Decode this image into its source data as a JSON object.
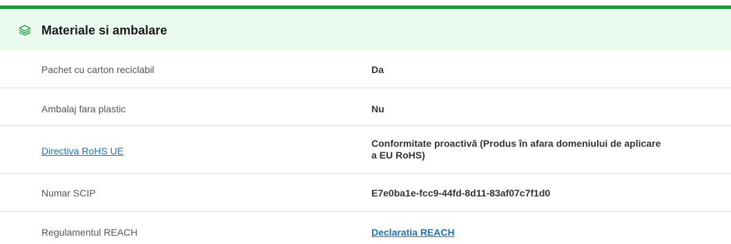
{
  "section": {
    "title": "Materiale si ambalare",
    "icon": "layers-icon",
    "accent_color": "#1e9a3c",
    "header_background": "#eafaee"
  },
  "rows": [
    {
      "label": "Pachet cu carton reciclabil",
      "value": "Da"
    },
    {
      "label": "Ambalaj fara plastic",
      "value": "Nu"
    },
    {
      "label": "Directiva RoHS UE",
      "value": "Conformitate proactivă (Produs în afara domeniului de aplicare a EU RoHS)"
    },
    {
      "label": "Numar SCIP",
      "value": "E7e0ba1e-fcc9-44fd-8d11-83af07c7f1d0"
    },
    {
      "label": "Regulamentul REACH",
      "value": "Declaratia REACH"
    }
  ],
  "colors": {
    "link": "#1a73b8",
    "label_text": "#555555",
    "value_text": "#333333",
    "divider": "#dcdcdc"
  }
}
